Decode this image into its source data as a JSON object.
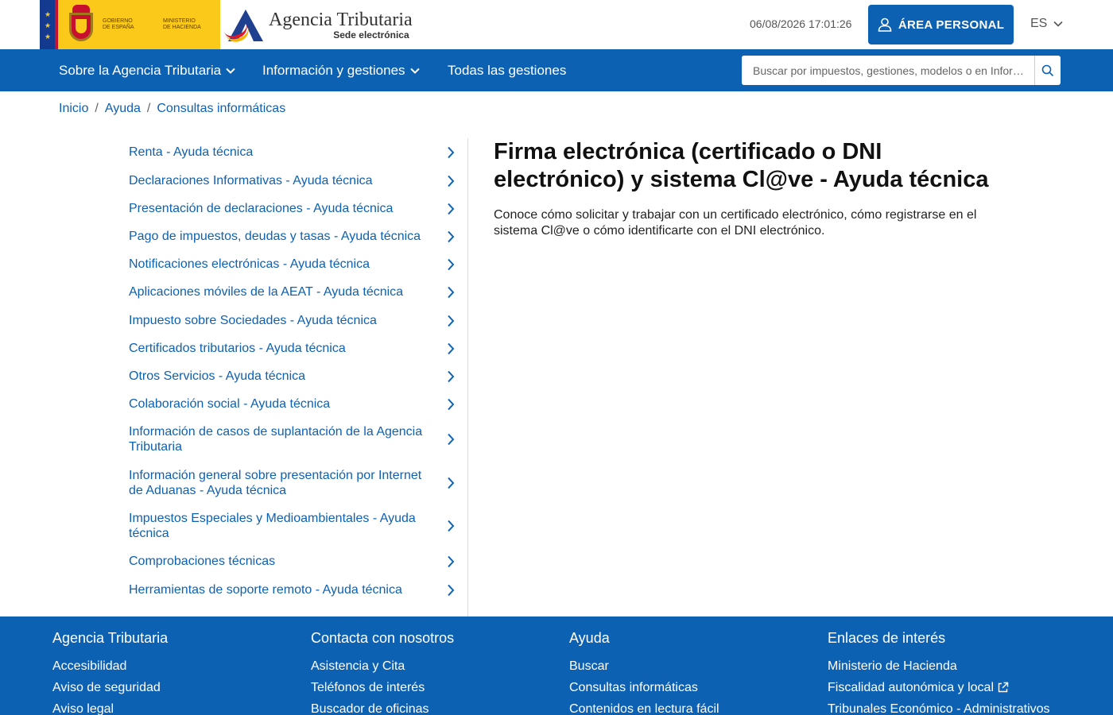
{
  "header": {
    "gov_text_line1": "GOBIERNO",
    "gov_text_line2": "DE ESPAÑA",
    "ministry_line1": "MINISTERIO",
    "ministry_line2": "DE HACIENDA",
    "agency_title": "Agencia Tributaria",
    "agency_subtitle": "Sede electrónica",
    "datetime": "06/08/2026 17:01:26",
    "area_personal_label": "ÁREA PERSONAL",
    "language": "ES"
  },
  "nav": {
    "items": [
      {
        "label": "Sobre la Agencia Tributaria",
        "has_dropdown": true
      },
      {
        "label": "Información y gestiones",
        "has_dropdown": true
      },
      {
        "label": "Todas las gestiones",
        "has_dropdown": false
      }
    ],
    "search_placeholder": "Buscar por impuestos, gestiones, modelos o en Infor…"
  },
  "breadcrumb": [
    "Inicio",
    "Ayuda",
    "Consultas informáticas"
  ],
  "sidebar": {
    "items": [
      {
        "label": "Renta - Ayuda técnica"
      },
      {
        "label": "Declaraciones Informativas - Ayuda técnica"
      },
      {
        "label": "Presentación de declaraciones - Ayuda técnica"
      },
      {
        "label": "Pago de impuestos, deudas y tasas - Ayuda técnica"
      },
      {
        "label": "Notificaciones electrónicas - Ayuda técnica"
      },
      {
        "label": "Aplicaciones móviles de la AEAT - Ayuda técnica"
      },
      {
        "label": "Impuesto sobre Sociedades - Ayuda técnica"
      },
      {
        "label": "Certificados tributarios - Ayuda técnica"
      },
      {
        "label": "Otros Servicios - Ayuda técnica"
      },
      {
        "label": "Colaboración social - Ayuda técnica"
      },
      {
        "label": "Información de casos de suplantación de la Agencia Tributaria"
      },
      {
        "label": "Información general sobre presentación por Internet de Aduanas - Ayuda técnica"
      },
      {
        "label": "Impuestos Especiales y Medioambientales - Ayuda técnica"
      },
      {
        "label": "Comprobaciones técnicas"
      },
      {
        "label": "Herramientas de soporte remoto - Ayuda técnica"
      }
    ]
  },
  "main": {
    "title": "Firma electrónica (certificado o DNI electrónico) y sistema Cl@ve - Ayuda técnica",
    "description": "Conoce cómo solicitar y trabajar con un certificado electrónico, cómo registrarse en el sistema Cl@ve o cómo identificarte con el DNI electrónico."
  },
  "footer": {
    "columns": [
      {
        "heading": "Agencia Tributaria",
        "links": [
          "Accesibilidad",
          "Aviso de seguridad",
          "Aviso legal"
        ]
      },
      {
        "heading": "Contacta con nosotros",
        "links": [
          "Asistencia y Cita",
          "Teléfonos de interés",
          "Buscador de oficinas"
        ]
      },
      {
        "heading": "Ayuda",
        "links": [
          "Buscar",
          "Consultas informáticas",
          "Contenidos en lectura fácil"
        ]
      },
      {
        "heading": "Enlaces de interés",
        "links": [
          "Ministerio de Hacienda",
          "Fiscalidad autonómica y local",
          "Tribunales Económico - Administrativos"
        ]
      }
    ]
  },
  "colors": {
    "primary_blue": "#0d61b3",
    "link_blue": "#0d61b3",
    "gov_yellow": "#fbc91a"
  }
}
